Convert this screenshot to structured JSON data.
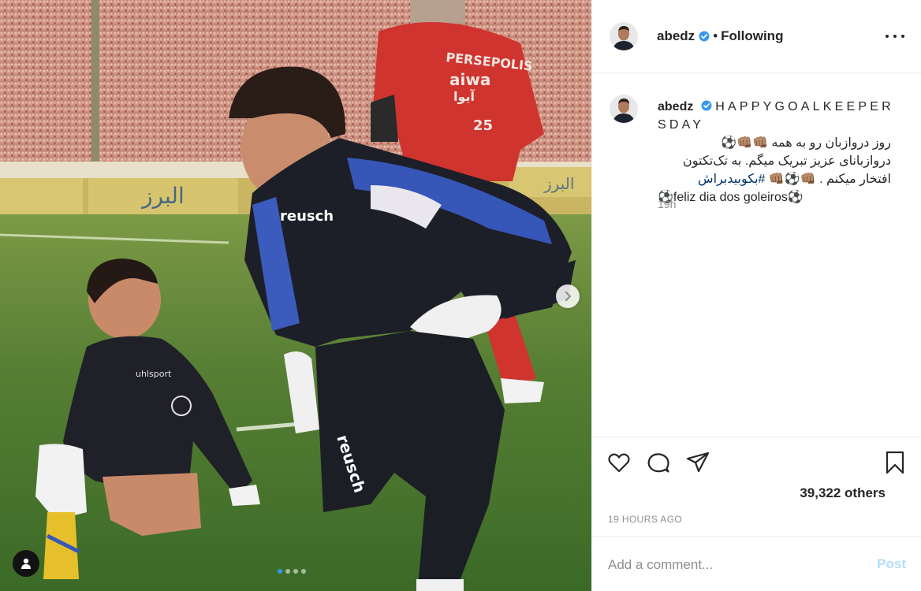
{
  "post": {
    "username": "abedz",
    "verified": true,
    "separator": "•",
    "follow_status": "Following",
    "more_icon": "more-horizontal-icon"
  },
  "caption": {
    "username": "abedz",
    "english": "HAPPYGOALKEEPERSDAY",
    "persian_line1": "روز دروازبان رو به همه",
    "emoji_group1": "👊🏽👊🏽⚽",
    "persian_line2": "دروازبانای عزیز تبریک میگم. به تک‌تکتون",
    "persian_line3": "افتخار میکنم .",
    "emoji_group2": "👊🏽⚽👊🏽",
    "hashtag": "#بکوبیدبراش",
    "portuguese": "⚽feliz dia dos goleiros⚽",
    "age": "19h"
  },
  "photo": {
    "jersey_text_top": "PERSEPOLIS",
    "jersey_text_sponsor": "aiwa",
    "jersey_text_sponsor_fa": "آیوا",
    "jersey_number": "25",
    "banner_text": "البرز",
    "keeper_brand": "reusch",
    "kid_brand": "uhlsport",
    "carousel_total": 4,
    "carousel_index": 1
  },
  "actions": {
    "like_icon": "heart-icon",
    "comment_icon": "comment-icon",
    "share_icon": "share-icon",
    "save_icon": "bookmark-icon",
    "likes_text": "39,322 others",
    "timestamp": "19 HOURS AGO"
  },
  "comment": {
    "placeholder": "Add a comment...",
    "post_label": "Post"
  },
  "colors": {
    "verified_blue": "#3897f0",
    "post_disabled": "#b2dffc",
    "link_dark_blue": "#003569",
    "muted": "#8e8e8e"
  }
}
